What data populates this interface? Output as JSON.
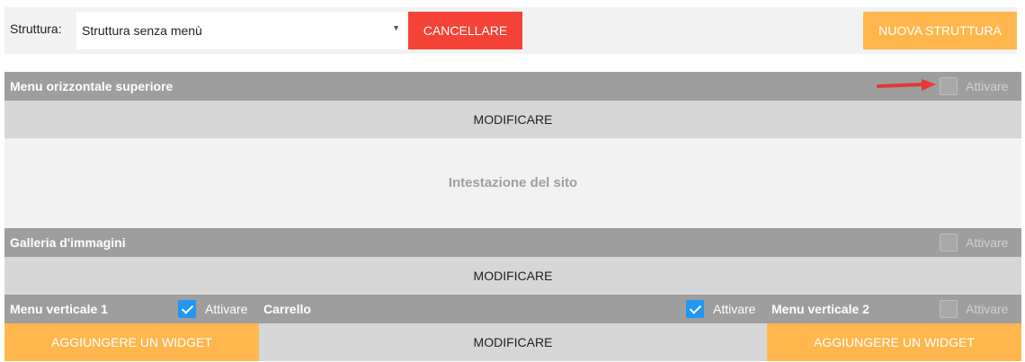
{
  "toolbar": {
    "label": "Struttura:",
    "select_value": "Struttura senza menù",
    "delete_label": "CANCELLARE",
    "new_label": "NUOVA STRUTTURA"
  },
  "sections": {
    "top_menu": {
      "title": "Menu orizzontale superiore",
      "activate_label": "Attivare",
      "active": false
    },
    "top_menu_edit": "MODIFICARE",
    "site_header": "Intestazione del sito",
    "gallery": {
      "title": "Galleria d'immagini",
      "activate_label": "Attivare",
      "active": false
    },
    "gallery_edit": "MODIFICARE",
    "vertical_menu_1": {
      "title": "Menu verticale 1",
      "activate_label": "Attivare",
      "active": true
    },
    "cart": {
      "title": "Carrello",
      "activate_label": "Attivare",
      "active": true
    },
    "vertical_menu_2": {
      "title": "Menu verticale 2",
      "activate_label": "Attivare",
      "active": false
    }
  },
  "bottom": {
    "add_widget_left": "AGGIUNGERE UN WIDGET",
    "edit": "MODIFICARE",
    "add_widget_right": "AGGIUNGERE UN WIDGET"
  },
  "colors": {
    "red": "#f44336",
    "orange": "#ffb74d",
    "bar_gray": "#9e9e9e",
    "checkbox_blue": "#2196f3",
    "arrow_red": "#e53935"
  },
  "icons": [
    "dropdown-caret-icon",
    "red-arrow-icon",
    "checkmark-icon"
  ]
}
